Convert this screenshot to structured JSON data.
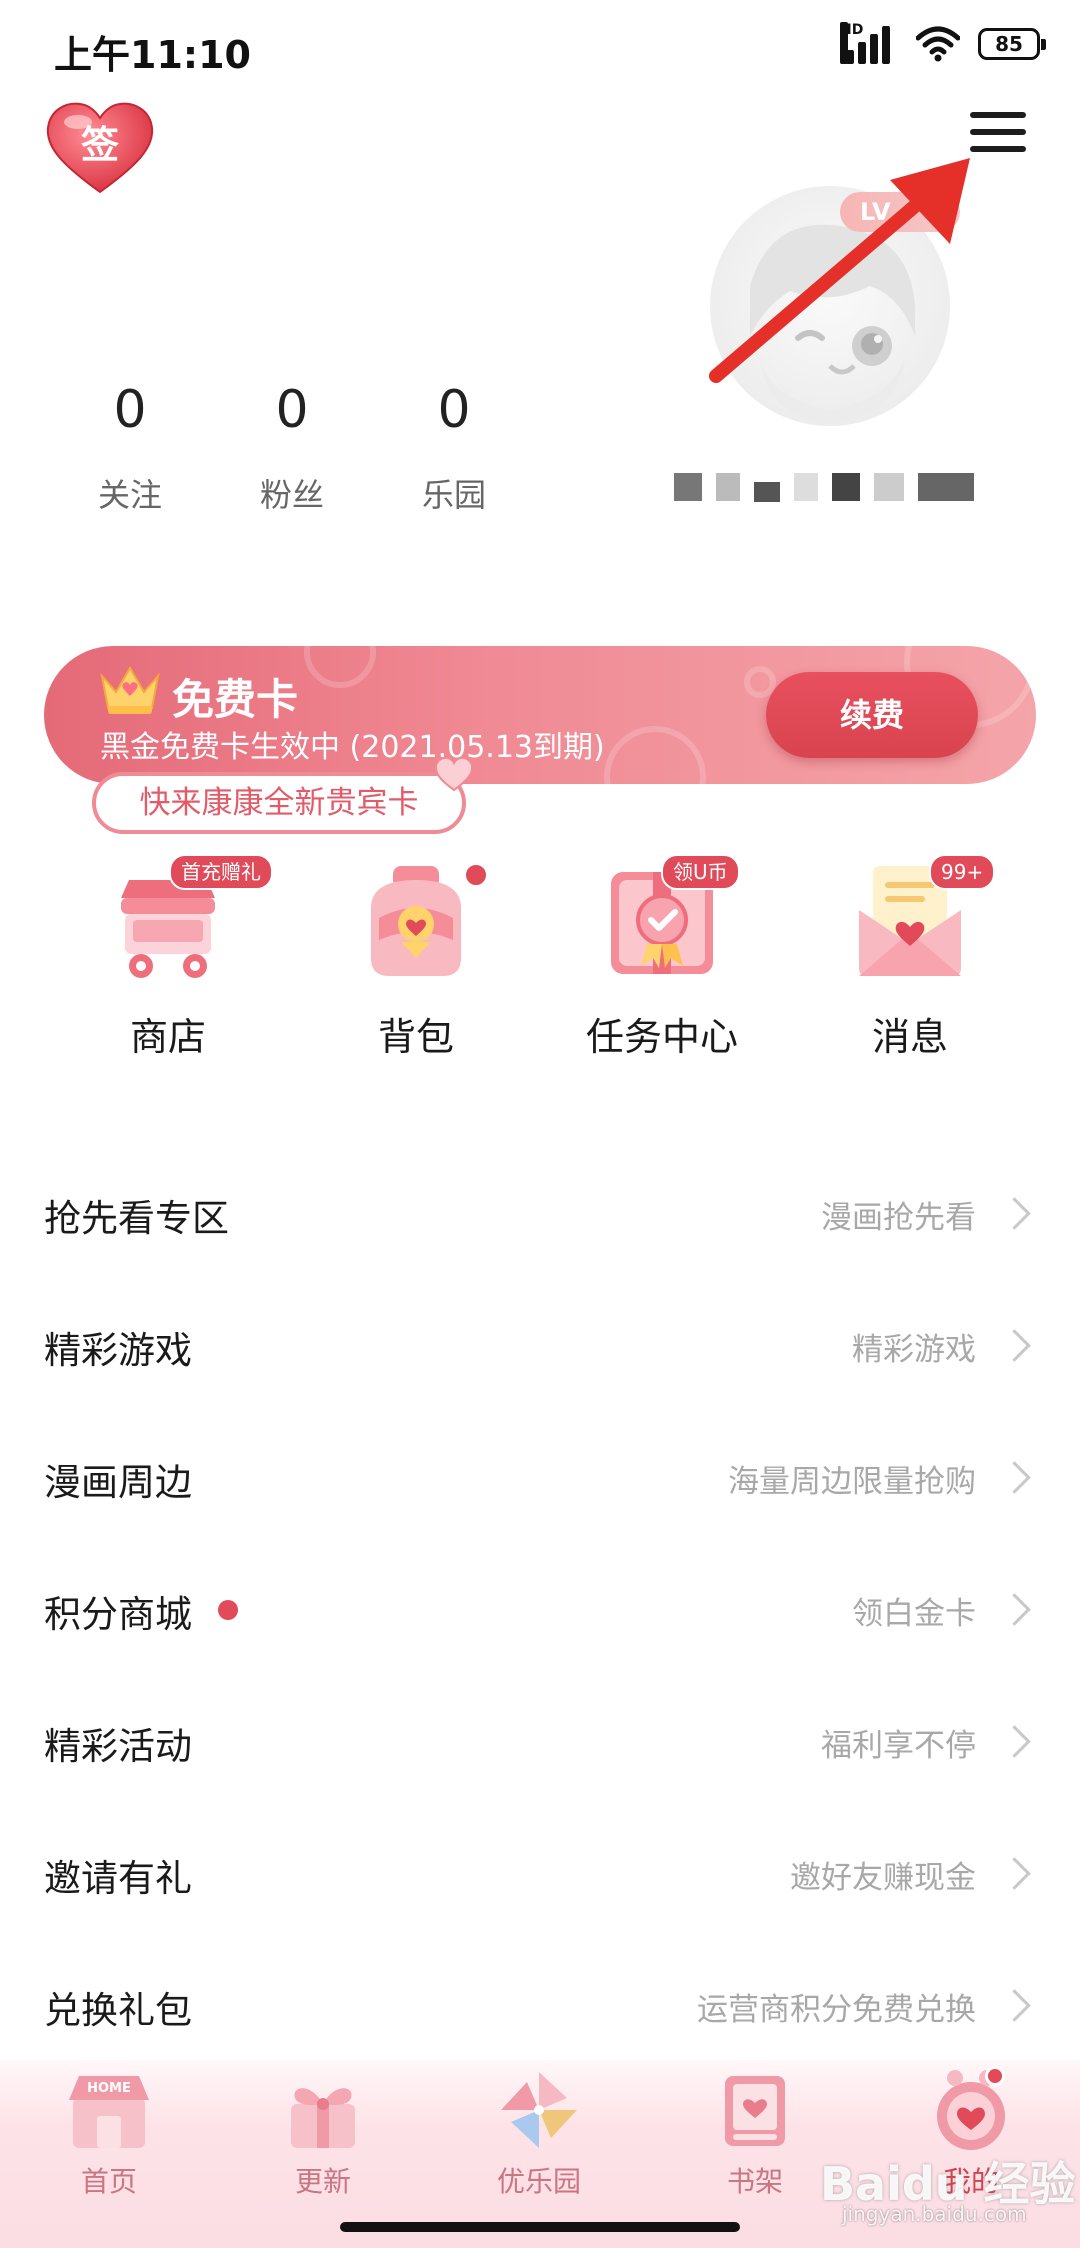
{
  "status_bar": {
    "time": "上午11:10",
    "network": "HD",
    "battery": "85"
  },
  "header": {
    "checkin_icon_text": "签",
    "level_badge": "LV"
  },
  "stats": [
    {
      "value": "0",
      "label": "关注"
    },
    {
      "value": "0",
      "label": "粉丝"
    },
    {
      "value": "0",
      "label": "乐园"
    }
  ],
  "vip_card": {
    "title": "免费卡",
    "subtitle": "黑金免费卡生效中 (2021.05.13到期)",
    "button": "续费",
    "tip": "快来康康全新贵宾卡"
  },
  "quick_actions": [
    {
      "label": "商店",
      "badge": "首充赠礼"
    },
    {
      "label": "背包",
      "badge": ""
    },
    {
      "label": "任务中心",
      "badge": "领U币"
    },
    {
      "label": "消息",
      "badge": "99+"
    }
  ],
  "menu_list": [
    {
      "title": "抢先看专区",
      "subtitle": "漫画抢先看"
    },
    {
      "title": "精彩游戏",
      "subtitle": "精彩游戏"
    },
    {
      "title": "漫画周边",
      "subtitle": "海量周边限量抢购"
    },
    {
      "title": "积分商城",
      "subtitle": "领白金卡"
    },
    {
      "title": "精彩活动",
      "subtitle": "福利享不停"
    },
    {
      "title": "邀请有礼",
      "subtitle": "邀好友赚现金"
    },
    {
      "title": "兑换礼包",
      "subtitle": "运营商积分免费兑换"
    }
  ],
  "bottom_nav": [
    {
      "label": "首页",
      "icon_text": "HOME"
    },
    {
      "label": "更新"
    },
    {
      "label": "优乐园"
    },
    {
      "label": "书架"
    },
    {
      "label": "我的"
    }
  ],
  "watermark": {
    "brand": "Baidu 经验",
    "url": "jingyan.baidu.com"
  },
  "colors": {
    "accent": "#e14a59",
    "banner": "#f08a94",
    "nav_bg": "#fde3e8"
  }
}
